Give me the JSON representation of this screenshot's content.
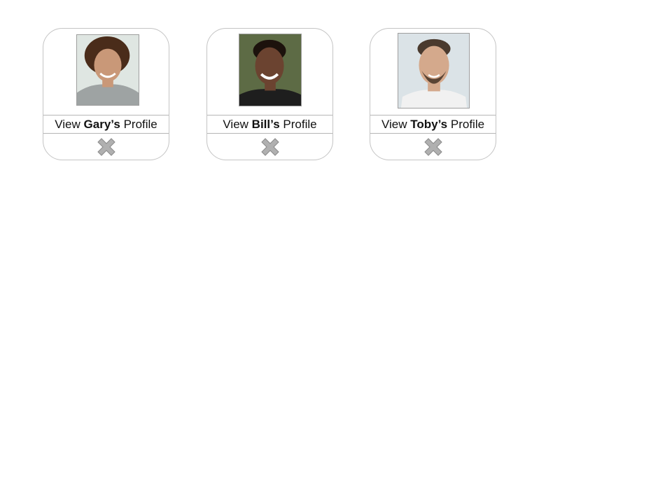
{
  "cards": [
    {
      "prefix": "View",
      "name": "Gary’s",
      "suffix": "Profile",
      "photo_alt": "Gary",
      "photo_colors": {
        "bg": "#dfe6e2",
        "hair": "#4a2c1a",
        "skin": "#c99878",
        "shirt": "#9ea3a3"
      }
    },
    {
      "prefix": "View",
      "name": "Bill’s",
      "suffix": "Profile",
      "photo_alt": "Bill",
      "photo_colors": {
        "bg": "#5d6b45",
        "hair": "#1c120c",
        "skin": "#6b4330",
        "shirt": "#1e1e1e"
      }
    },
    {
      "prefix": "View",
      "name": "Toby’s",
      "suffix": "Profile",
      "photo_alt": "Toby",
      "photo_colors": {
        "bg": "#dbe3e7",
        "hair": "#4a3a2e",
        "skin": "#d4a98c",
        "shirt": "#f1f1f1"
      }
    }
  ],
  "close_icon": {
    "fill": "#b0b0b0",
    "stroke": "#8a8a8a"
  }
}
